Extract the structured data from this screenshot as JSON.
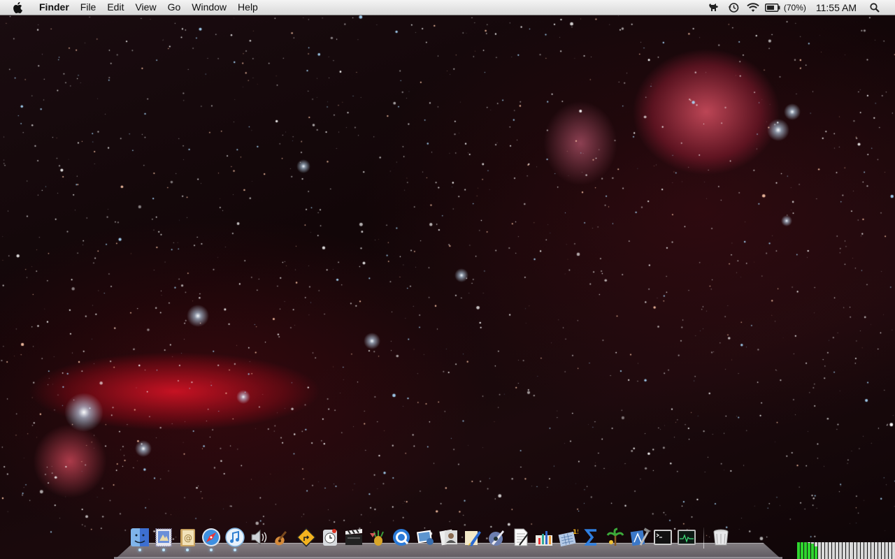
{
  "menubar": {
    "app_name": "Finder",
    "menus": [
      "File",
      "Edit",
      "View",
      "Go",
      "Window",
      "Help"
    ],
    "battery_percent": "(70%)",
    "clock": "11:55 AM"
  },
  "status_icons": [
    "growl-dog-icon",
    "time-machine-icon",
    "wifi-icon",
    "battery-icon",
    "spotlight-icon"
  ],
  "dock": {
    "apps": [
      {
        "name": "finder",
        "icon": "finder-icon",
        "running": true
      },
      {
        "name": "mail",
        "icon": "mail-stamp-icon",
        "running": true
      },
      {
        "name": "address-book",
        "icon": "address-book-icon",
        "running": true
      },
      {
        "name": "safari",
        "icon": "compass-icon",
        "running": true
      },
      {
        "name": "itunes",
        "icon": "music-note-icon",
        "running": true
      },
      {
        "name": "audio",
        "icon": "speaker-icon",
        "running": false
      },
      {
        "name": "garageband",
        "icon": "guitar-icon",
        "running": false
      },
      {
        "name": "console",
        "icon": "warning-sign-icon",
        "running": false
      },
      {
        "name": "time-machine",
        "icon": "clock-icon",
        "running": false
      },
      {
        "name": "imovie",
        "icon": "clapperboard-icon",
        "running": false
      },
      {
        "name": "cocktail",
        "icon": "cocktail-icon",
        "running": false
      },
      {
        "name": "quicktime",
        "icon": "quicktime-icon",
        "running": false
      },
      {
        "name": "iphoto",
        "icon": "photos-icon",
        "running": false
      },
      {
        "name": "photo-booth",
        "icon": "photo-stack-icon",
        "running": false
      },
      {
        "name": "sketch",
        "icon": "paint-brush-icon",
        "running": false
      },
      {
        "name": "pen-tool",
        "icon": "pen-nib-icon",
        "running": false
      },
      {
        "name": "textedit",
        "icon": "document-icon",
        "running": false
      },
      {
        "name": "numbers",
        "icon": "bar-chart-icon",
        "running": false
      },
      {
        "name": "calendar-tool",
        "icon": "calendar-icon",
        "running": false
      },
      {
        "name": "sum",
        "icon": "sigma-icon",
        "running": false
      },
      {
        "name": "uploader",
        "icon": "palm-tree-icon",
        "running": false
      },
      {
        "name": "xcode",
        "icon": "hammer-icon",
        "running": false
      },
      {
        "name": "terminal",
        "icon": "terminal-icon",
        "running": false
      },
      {
        "name": "activity-monitor",
        "icon": "activity-monitor-icon",
        "running": false
      }
    ],
    "trash_icon": "trash-icon"
  },
  "cpu_meter": {
    "levels": [
      1,
      1,
      1,
      0.95,
      0.9,
      0.75,
      0,
      0,
      0,
      0,
      0,
      0,
      0,
      0,
      0,
      0,
      0,
      0,
      0,
      0,
      0,
      0,
      0,
      0,
      0,
      0,
      0,
      0
    ]
  }
}
